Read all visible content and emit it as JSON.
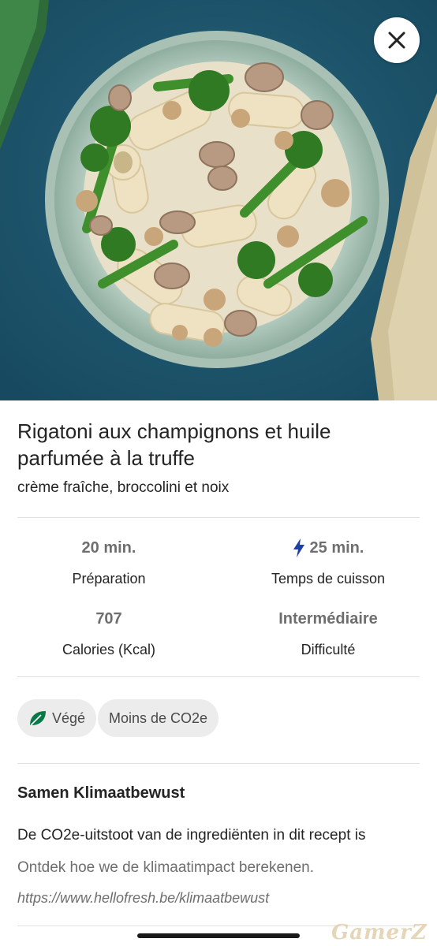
{
  "hero": {
    "image_alt": "Rigatoni pasta bowl with mushrooms, broccolini and walnuts"
  },
  "close_icon": "close-icon",
  "recipe": {
    "title": "Rigatoni aux champignons et huile parfumée à la truffe",
    "subtitle": "crème fraîche, broccolini et noix"
  },
  "stats": {
    "prep_value": "20 min.",
    "prep_label": "Préparation",
    "cook_value": "25 min.",
    "cook_label": "Temps de cuisson",
    "cook_icon": "lightning-icon",
    "calories_value": "707",
    "calories_label": "Calories (Kcal)",
    "difficulty_value": "Intermédiaire",
    "difficulty_label": "Difficulté"
  },
  "tags": [
    {
      "label": "Végé",
      "icon": "leaf-icon"
    },
    {
      "label": "Moins de CO2e"
    }
  ],
  "climate": {
    "title": "Samen Klimaatbewust",
    "text": "De CO2e-uitstoot van de ingrediënten in dit recept is",
    "link": "Ontdek hoe we de klimaatimpact berekenen.",
    "url": "https://www.hellofresh.be/klimaatbewust"
  },
  "watermark": "GamerZ",
  "colors": {
    "accent": "#067a46",
    "lightning": "#1f3fa8",
    "hero_bg": "#1f5870"
  }
}
